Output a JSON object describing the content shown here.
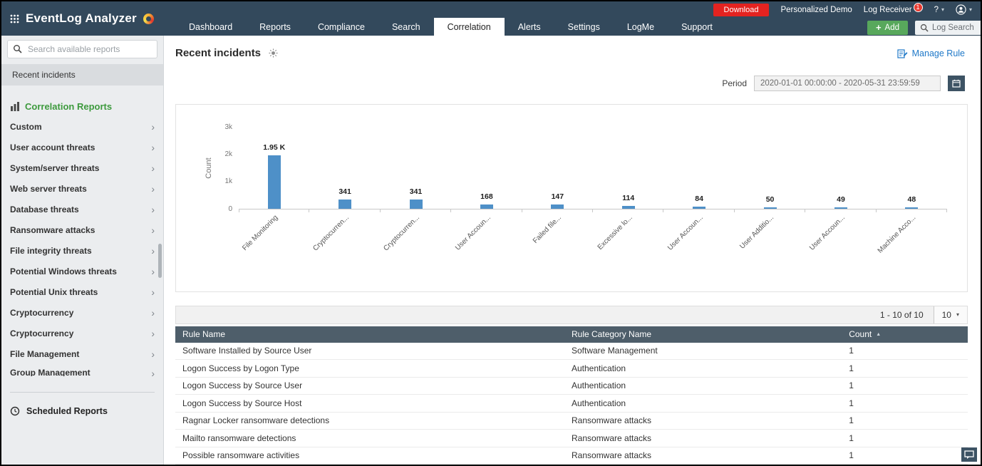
{
  "icons": {
    "chevron_right": "›",
    "caret_down": "▾",
    "sort_asc": "▲",
    "plus": "+"
  },
  "header": {
    "logo_title": "EventLog Analyzer",
    "nav_tabs": [
      "Dashboard",
      "Reports",
      "Compliance",
      "Search",
      "Correlation",
      "Alerts",
      "Settings",
      "LogMe",
      "Support"
    ],
    "active_tab": "Correlation",
    "download_label": "Download",
    "personalized_demo_label": "Personalized Demo",
    "log_receiver_label": "Log Receiver",
    "log_receiver_badge": "1",
    "help_label": "?",
    "add_label": "Add",
    "log_search_placeholder": "Log Search"
  },
  "sidebar": {
    "search_placeholder": "Search available reports",
    "recent_item": "Recent incidents",
    "section_title": "Correlation Reports",
    "items": [
      "Custom",
      "User account threats",
      "System/server threats",
      "Web server threats",
      "Database threats",
      "Ransomware attacks",
      "File integrity threats",
      "Potential Windows threats",
      "Potential Unix threats",
      "Cryptocurrency",
      "Cryptocurrency",
      "File Management"
    ],
    "cut_item": "Group Management",
    "scheduled_reports": "Scheduled Reports"
  },
  "main": {
    "title": "Recent incidents",
    "manage_rule_label": "Manage Rule",
    "period_label": "Period",
    "period_value": "2020-01-01 00:00:00 - 2020-05-31 23:59:59"
  },
  "chart_data": {
    "type": "bar",
    "title": "Recent incidents",
    "categories": [
      "File Monitoring",
      "Cryptocurren...",
      "Cryptocurren...",
      "User Accoun...",
      "Failed file...",
      "Excessive lo...",
      "User Accoun...",
      "User Additio...",
      "User Accoun...",
      "Machine Acco..."
    ],
    "values": [
      1950,
      341,
      341,
      168,
      147,
      114,
      84,
      50,
      49,
      48
    ],
    "value_labels": [
      "1.95 K",
      "341",
      "341",
      "168",
      "147",
      "114",
      "84",
      "50",
      "49",
      "48"
    ],
    "xlabel": "",
    "ylabel": "Count",
    "ylim": [
      0,
      3000
    ],
    "yticks": [
      {
        "value": 0,
        "label": "0"
      },
      {
        "value": 1000,
        "label": "1k"
      },
      {
        "value": 2000,
        "label": "2k"
      },
      {
        "value": 3000,
        "label": "3k"
      }
    ],
    "grid": false,
    "legend": "none",
    "bar_color": "#4e90c8"
  },
  "table": {
    "pagination_info": "1 - 10 of 10",
    "page_size": "10",
    "columns": [
      "Rule Name",
      "Rule Category Name",
      "Count"
    ],
    "sorted_column": "Count",
    "rows": [
      {
        "rule": "Software Installed by Source User",
        "category": "Software Management",
        "count": "1"
      },
      {
        "rule": "Logon Success by Logon Type",
        "category": "Authentication",
        "count": "1"
      },
      {
        "rule": "Logon Success by Source User",
        "category": "Authentication",
        "count": "1"
      },
      {
        "rule": "Logon Success by Source Host",
        "category": "Authentication",
        "count": "1"
      },
      {
        "rule": "Ragnar Locker ransomware detections",
        "category": "Ransomware attacks",
        "count": "1"
      },
      {
        "rule": "Mailto ransomware detections",
        "category": "Ransomware attacks",
        "count": "1"
      },
      {
        "rule": "Possible ransomware activities",
        "category": "Ransomware attacks",
        "count": "1"
      }
    ]
  }
}
